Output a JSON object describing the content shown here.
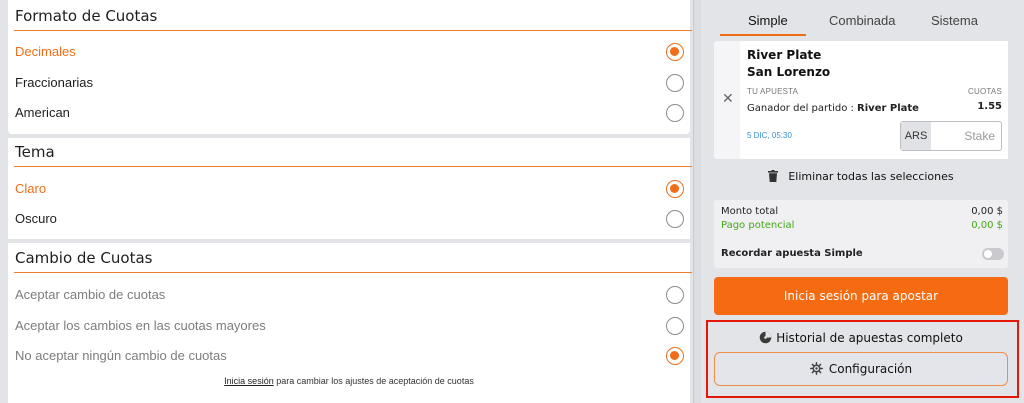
{
  "settings": {
    "odds_format": {
      "title": "Formato de Cuotas",
      "options": [
        {
          "label": "Decimales",
          "selected": true
        },
        {
          "label": "Fraccionarias",
          "selected": false
        },
        {
          "label": "American",
          "selected": false
        }
      ]
    },
    "theme": {
      "title": "Tema",
      "options": [
        {
          "label": "Claro",
          "selected": true
        },
        {
          "label": "Oscuro",
          "selected": false
        }
      ]
    },
    "odds_change": {
      "title": "Cambio de Cuotas",
      "options": [
        {
          "label": "Aceptar cambio de cuotas",
          "selected": false
        },
        {
          "label": "Aceptar los cambios en las cuotas mayores",
          "selected": false
        },
        {
          "label": "No aceptar ningún cambio de cuotas",
          "selected": true
        }
      ],
      "footnote_link": "Inicia sesión",
      "footnote_text": " para cambiar los ajustes de aceptación de cuotas"
    }
  },
  "betslip": {
    "tabs": [
      {
        "label": "Simple",
        "active": true
      },
      {
        "label": "Combinada",
        "active": false
      },
      {
        "label": "Sistema",
        "active": false
      }
    ],
    "bet": {
      "team1": "River Plate",
      "team2": "San Lorenzo",
      "your_bet_label": "TU APUESTA",
      "odds_label": "CUOTAS",
      "market_text": "Ganador del partido : ",
      "selection": "River Plate",
      "odds_value": "1.55",
      "date": "5 DIC, 05:30",
      "currency": "ARS",
      "stake_placeholder": "Stake"
    },
    "clear_all_label": "Eliminar todas las selecciones",
    "totals": {
      "total_label": "Monto total",
      "total_value": "0,00 $",
      "potential_label": "Pago potencial",
      "potential_value": "0,00 $",
      "remember_label": "Recordar apuesta Simple",
      "remember_on": false
    },
    "login_button": "Inicia sesión para apostar",
    "history_link": "Historial de apuestas completo",
    "config_button": "Configuración"
  },
  "colors": {
    "accent": "#f06e1a",
    "button_orange": "#f46b12",
    "potential_green": "#43a816",
    "date_blue": "#3d8fd6",
    "highlight_red": "#e3170a"
  },
  "icons": [
    "close-icon",
    "trash-icon",
    "history-icon",
    "gear-icon",
    "radio-icon"
  ]
}
